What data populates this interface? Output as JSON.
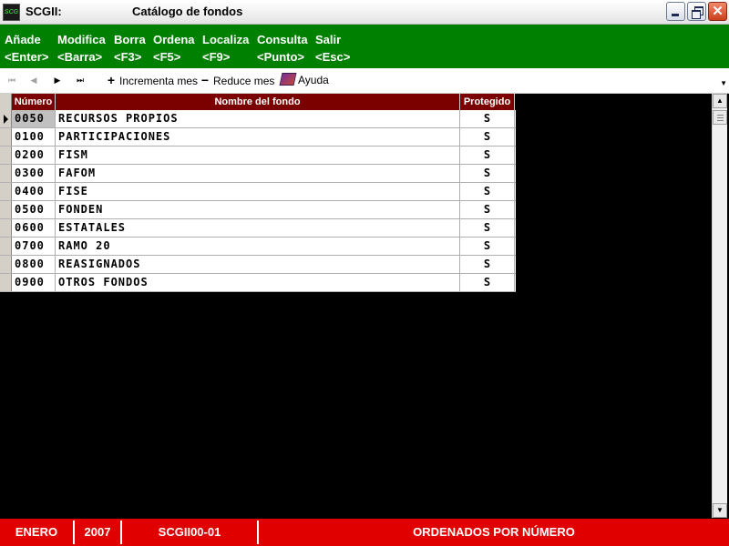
{
  "window": {
    "app_icon_text": "SCG",
    "app_name": "SCGII:",
    "title": "Catálogo de fondos"
  },
  "menu": [
    {
      "label": "Añade",
      "key": "<Enter>"
    },
    {
      "label": "Modifica",
      "key": "<Barra>"
    },
    {
      "label": "Borra",
      "key": "<F3>"
    },
    {
      "label": "Ordena",
      "key": "<F5>"
    },
    {
      "label": "Localiza",
      "key": "<F9>"
    },
    {
      "label": "Consulta",
      "key": "<Punto>"
    },
    {
      "label": "Salir",
      "key": "<Esc>"
    }
  ],
  "toolbar": {
    "increment_label": "Incrementa mes",
    "reduce_label": "Reduce mes",
    "help_label": "Ayuda"
  },
  "table": {
    "headers": {
      "number": "Número",
      "name": "Nombre del fondo",
      "protected": "Protegido"
    },
    "rows": [
      {
        "number": "0050",
        "name": "RECURSOS PROPIOS",
        "protected": "S"
      },
      {
        "number": "0100",
        "name": "PARTICIPACIONES",
        "protected": "S"
      },
      {
        "number": "0200",
        "name": "FISM",
        "protected": "S"
      },
      {
        "number": "0300",
        "name": "FAFOM",
        "protected": "S"
      },
      {
        "number": "0400",
        "name": "FISE",
        "protected": "S"
      },
      {
        "number": "0500",
        "name": "FONDEN",
        "protected": "S"
      },
      {
        "number": "0600",
        "name": "ESTATALES",
        "protected": "S"
      },
      {
        "number": "0700",
        "name": "RAMO 20",
        "protected": "S"
      },
      {
        "number": "0800",
        "name": "REASIGNADOS",
        "protected": "S"
      },
      {
        "number": "0900",
        "name": "OTROS FONDOS",
        "protected": "S"
      }
    ]
  },
  "status": {
    "month": "ENERO",
    "year": "2007",
    "module": "SCGII00-01",
    "message": "ORDENADOS POR NÚMERO"
  },
  "colors": {
    "menu_bg": "#008000",
    "header_bg": "#7b0000",
    "status_bg": "#e00000"
  }
}
